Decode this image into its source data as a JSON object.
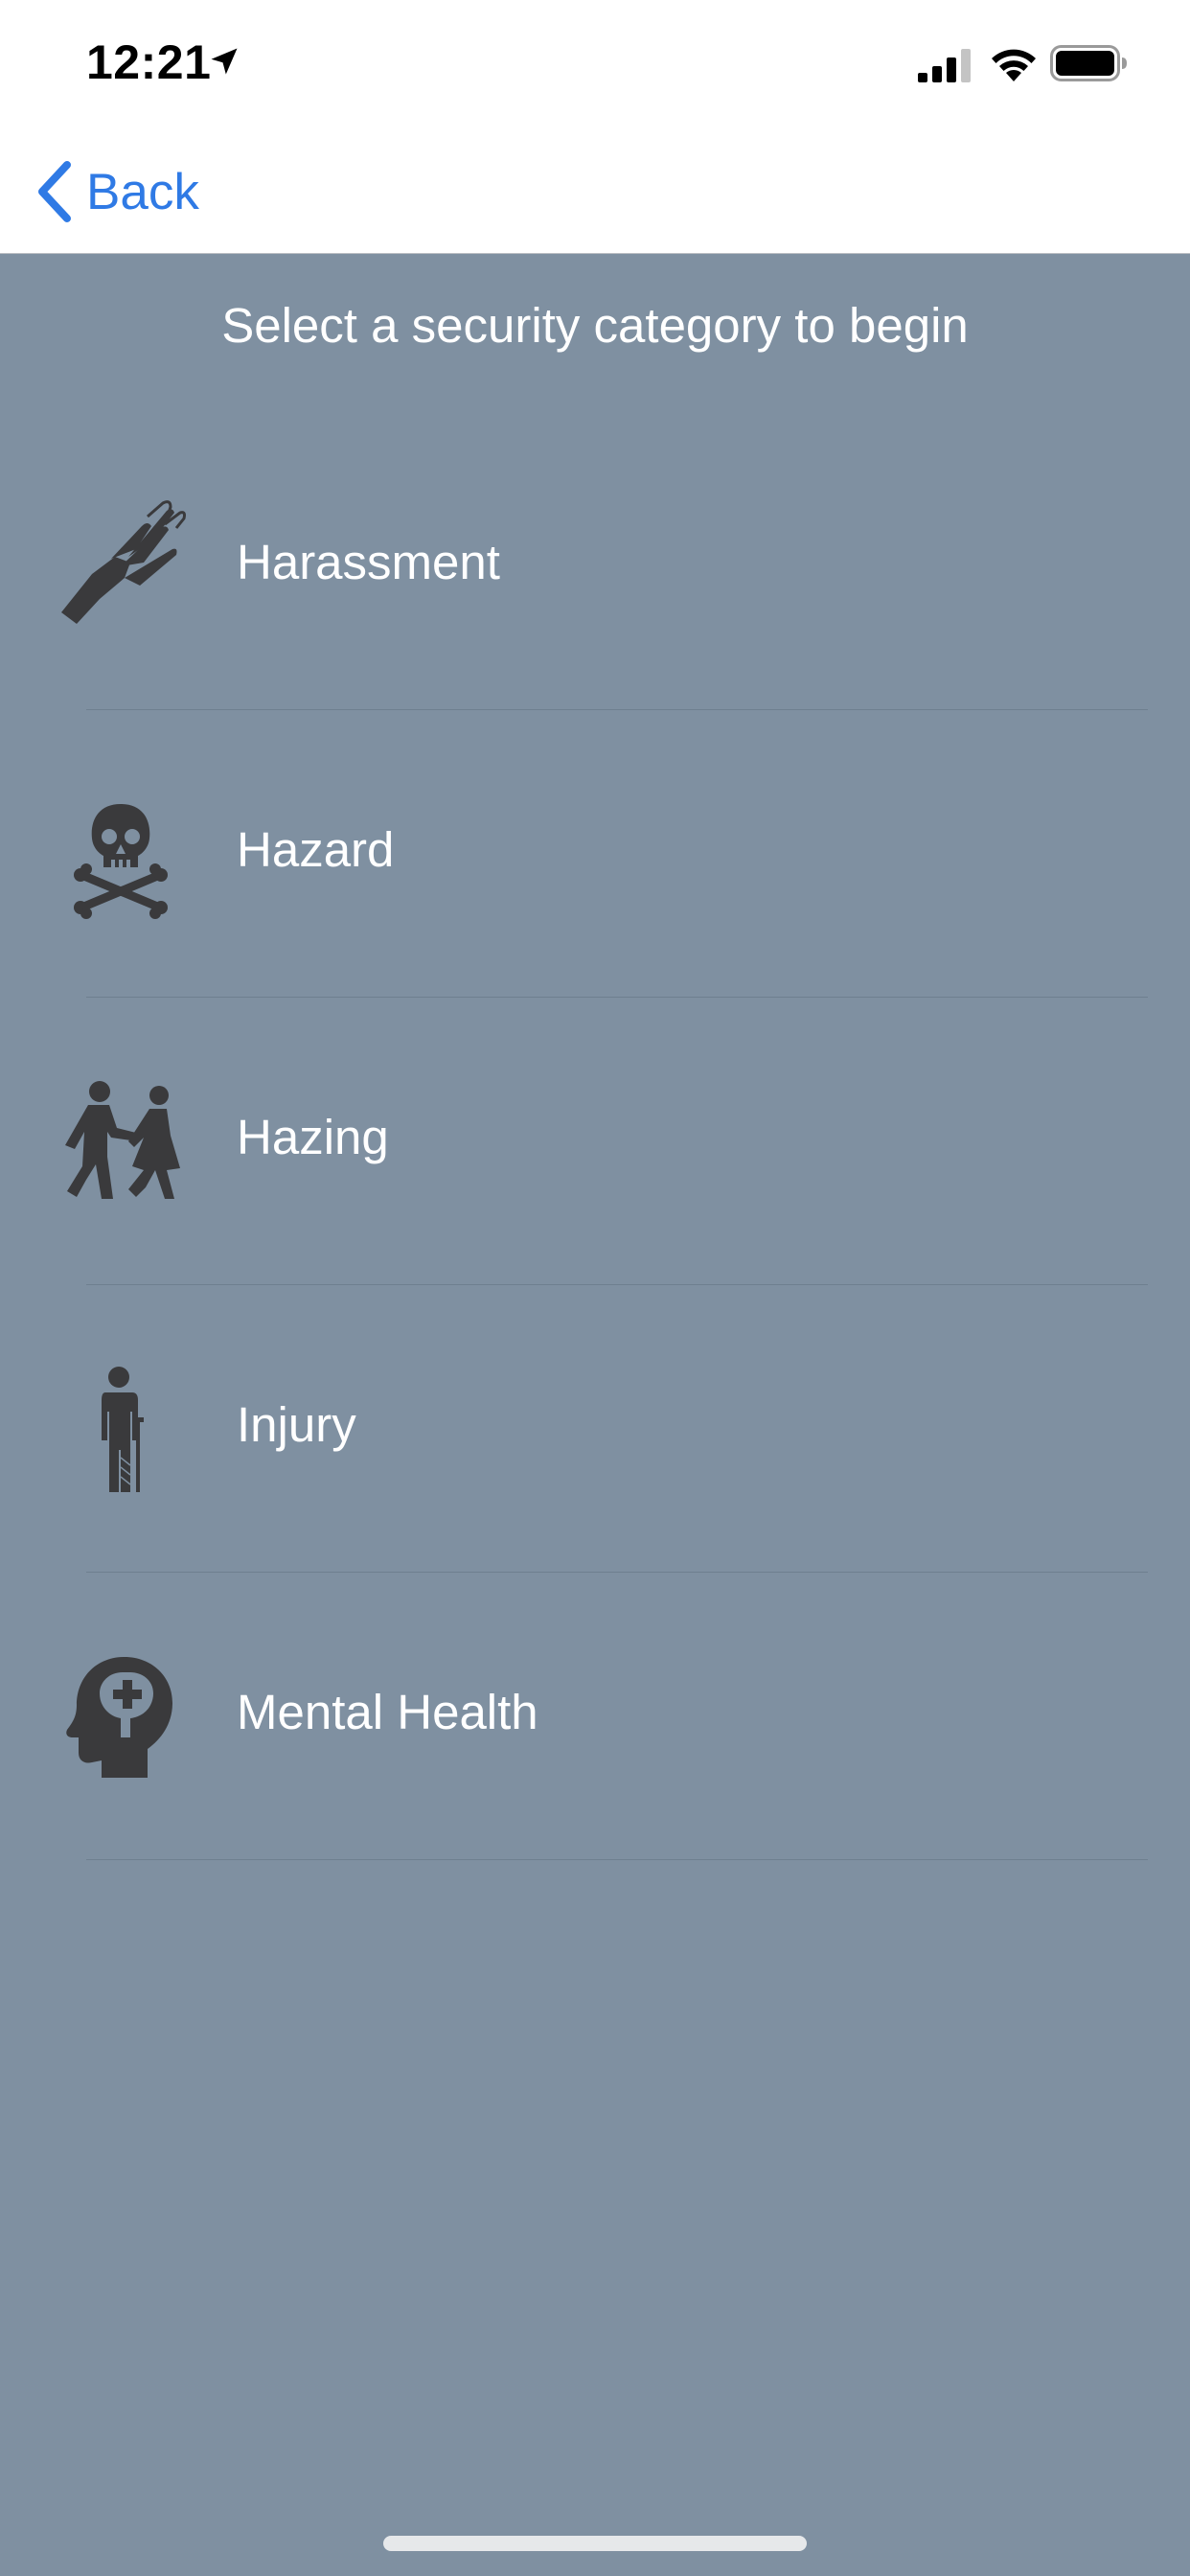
{
  "status_bar": {
    "time": "12:21"
  },
  "nav": {
    "back_label": "Back"
  },
  "prompt": "Select a security category to begin",
  "categories": [
    {
      "label": "Harassment",
      "icon": "harassment-hand-icon"
    },
    {
      "label": "Hazard",
      "icon": "skull-crossbones-icon"
    },
    {
      "label": "Hazing",
      "icon": "hazing-people-icon"
    },
    {
      "label": "Injury",
      "icon": "injured-person-icon"
    },
    {
      "label": "Mental Health",
      "icon": "mental-health-head-icon"
    }
  ],
  "colors": {
    "background": "#7f90a1",
    "accent": "#2f7ae5",
    "icon": "#3a3a3c",
    "text": "#ffffff"
  }
}
